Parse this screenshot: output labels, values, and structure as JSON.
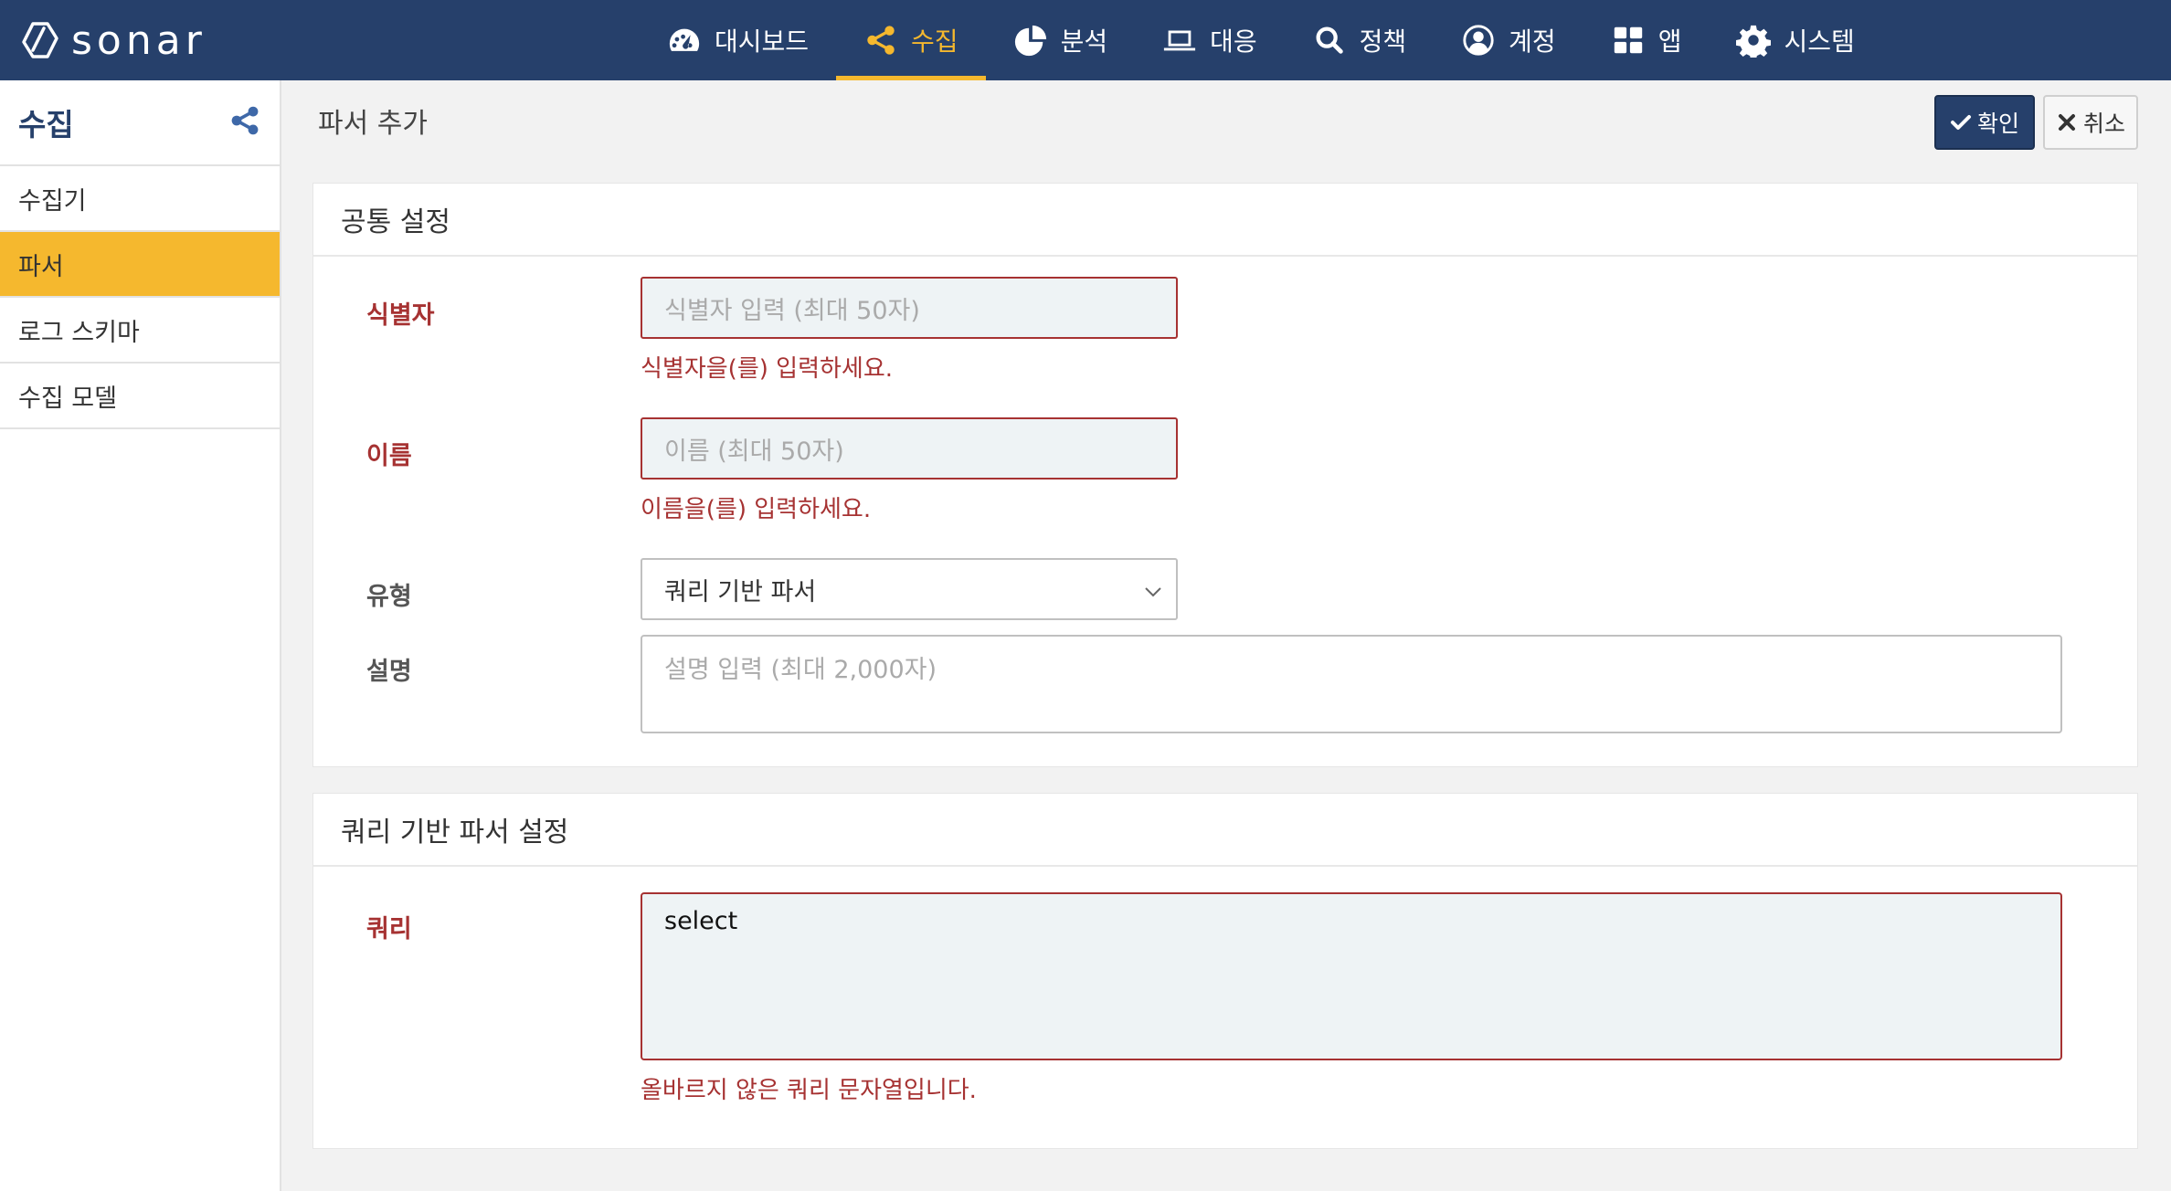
{
  "app": {
    "logo_text": "sonar"
  },
  "nav": [
    {
      "label": "대시보드",
      "icon": "dashboard-icon"
    },
    {
      "label": "수집",
      "icon": "share-icon",
      "active": true
    },
    {
      "label": "분석",
      "icon": "pie-chart-icon"
    },
    {
      "label": "대응",
      "icon": "laptop-icon"
    },
    {
      "label": "정책",
      "icon": "search-icon"
    },
    {
      "label": "계정",
      "icon": "user-circle-icon"
    },
    {
      "label": "앱",
      "icon": "grid-icon"
    },
    {
      "label": "시스템",
      "icon": "gear-icon"
    }
  ],
  "sidebar": {
    "title": "수집",
    "items": [
      {
        "label": "수집기"
      },
      {
        "label": "파서",
        "active": true
      },
      {
        "label": "로그 스키마"
      },
      {
        "label": "수집 모델"
      }
    ]
  },
  "page": {
    "title": "파서 추가",
    "confirm_label": "확인",
    "cancel_label": "취소"
  },
  "common": {
    "title": "공통 설정",
    "identifier": {
      "label": "식별자",
      "placeholder": "식별자 입력 (최대 50자)",
      "error": "식별자을(를) 입력하세요."
    },
    "name": {
      "label": "이름",
      "placeholder": "이름 (최대 50자)",
      "error": "이름을(를) 입력하세요."
    },
    "type": {
      "label": "유형",
      "value": "쿼리 기반 파서"
    },
    "description": {
      "label": "설명",
      "placeholder": "설명 입력 (최대 2,000자)"
    }
  },
  "query_section": {
    "title": "쿼리 기반 파서 설정",
    "query": {
      "label": "쿼리",
      "value": "select",
      "error": "올바르지 않은 쿼리 문자열입니다."
    }
  },
  "colors": {
    "nav_bg": "#26406b",
    "accent": "#f5b82e",
    "error": "#a63232"
  }
}
